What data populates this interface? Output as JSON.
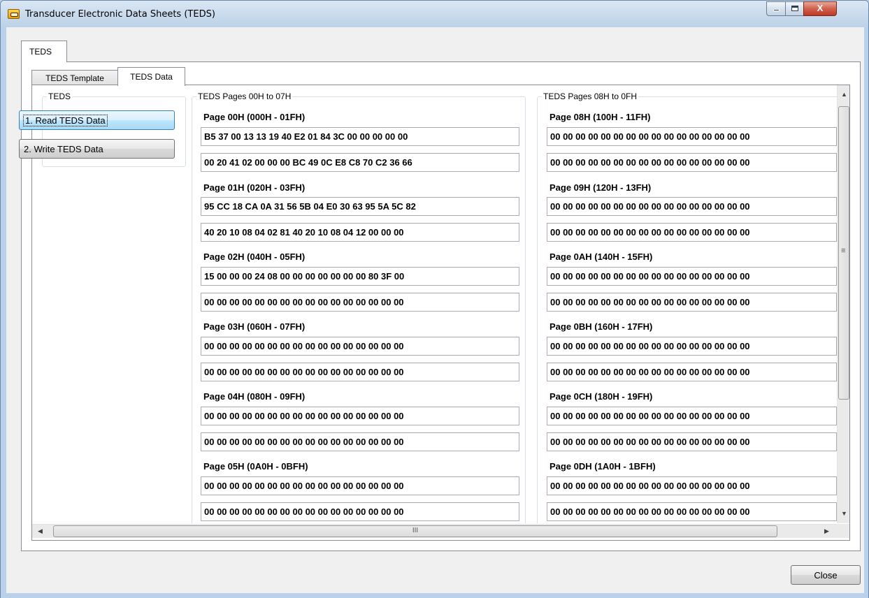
{
  "window": {
    "title": "Transducer Electronic Data Sheets (TEDS)",
    "minimize_label": "",
    "maximize_label": "",
    "close_label": "X"
  },
  "outer_tab": {
    "label": "TEDS"
  },
  "inner_tabs": [
    {
      "label": "TEDS Template",
      "selected": false
    },
    {
      "label": "TEDS Data",
      "selected": true
    }
  ],
  "teds_group": {
    "title": "TEDS",
    "read_button": "1. Read TEDS Data",
    "write_button": "2. Write TEDS Data"
  },
  "group1": {
    "title": "TEDS Pages 00H to 07H",
    "pages": [
      {
        "label": "Page 00H (000H - 01FH)",
        "rows": [
          "B5 37 00 13 13 19 40 E2 01 84 3C 00 00 00 00 00",
          "00 20 41 02 00 00 00 BC 49 0C E8 C8 70 C2 36 66"
        ]
      },
      {
        "label": "Page 01H (020H - 03FH)",
        "rows": [
          "95 CC 18 CA 0A 31 56 5B 04 E0 30 63 95 5A 5C 82",
          "40 20 10 08 04 02 81 40 20 10 08 04 12 00 00 00"
        ]
      },
      {
        "label": "Page 02H (040H - 05FH)",
        "rows": [
          "15 00 00 00 24 08 00 00 00 00 00 00 00 80 3F 00",
          "00 00 00 00 00 00 00 00 00 00 00 00 00 00 00 00"
        ]
      },
      {
        "label": "Page 03H (060H - 07FH)",
        "rows": [
          "00 00 00 00 00 00 00 00 00 00 00 00 00 00 00 00",
          "00 00 00 00 00 00 00 00 00 00 00 00 00 00 00 00"
        ]
      },
      {
        "label": "Page 04H (080H - 09FH)",
        "rows": [
          "00 00 00 00 00 00 00 00 00 00 00 00 00 00 00 00",
          "00 00 00 00 00 00 00 00 00 00 00 00 00 00 00 00"
        ]
      },
      {
        "label": "Page 05H (0A0H - 0BFH)",
        "rows": [
          "00 00 00 00 00 00 00 00 00 00 00 00 00 00 00 00",
          "00 00 00 00 00 00 00 00 00 00 00 00 00 00 00 00"
        ]
      }
    ]
  },
  "group2": {
    "title": "TEDS Pages 08H to 0FH",
    "pages": [
      {
        "label": "Page 08H (100H - 11FH)",
        "rows": [
          "00 00 00 00 00 00 00 00 00 00 00 00 00 00 00 00",
          "00 00 00 00 00 00 00 00 00 00 00 00 00 00 00 00"
        ]
      },
      {
        "label": "Page 09H (120H - 13FH)",
        "rows": [
          "00 00 00 00 00 00 00 00 00 00 00 00 00 00 00 00",
          "00 00 00 00 00 00 00 00 00 00 00 00 00 00 00 00"
        ]
      },
      {
        "label": "Page 0AH (140H - 15FH)",
        "rows": [
          "00 00 00 00 00 00 00 00 00 00 00 00 00 00 00 00",
          "00 00 00 00 00 00 00 00 00 00 00 00 00 00 00 00"
        ]
      },
      {
        "label": "Page 0BH (160H - 17FH)",
        "rows": [
          "00 00 00 00 00 00 00 00 00 00 00 00 00 00 00 00",
          "00 00 00 00 00 00 00 00 00 00 00 00 00 00 00 00"
        ]
      },
      {
        "label": "Page 0CH (180H - 19FH)",
        "rows": [
          "00 00 00 00 00 00 00 00 00 00 00 00 00 00 00 00",
          "00 00 00 00 00 00 00 00 00 00 00 00 00 00 00 00"
        ]
      },
      {
        "label": "Page 0DH (1A0H - 1BFH)",
        "rows": [
          "00 00 00 00 00 00 00 00 00 00 00 00 00 00 00 00",
          "00 00 00 00 00 00 00 00 00 00 00 00 00 00 00 00"
        ]
      }
    ]
  },
  "scrollbars": {
    "h_grip": "III",
    "v_grip": "≡"
  },
  "footer": {
    "close_button": "Close"
  },
  "icons": {
    "app": "teds-app-icon",
    "left": "scroll-left-arrow-icon",
    "right": "scroll-right-arrow-icon",
    "up": "scroll-up-arrow-icon",
    "down": "scroll-down-arrow-icon"
  }
}
